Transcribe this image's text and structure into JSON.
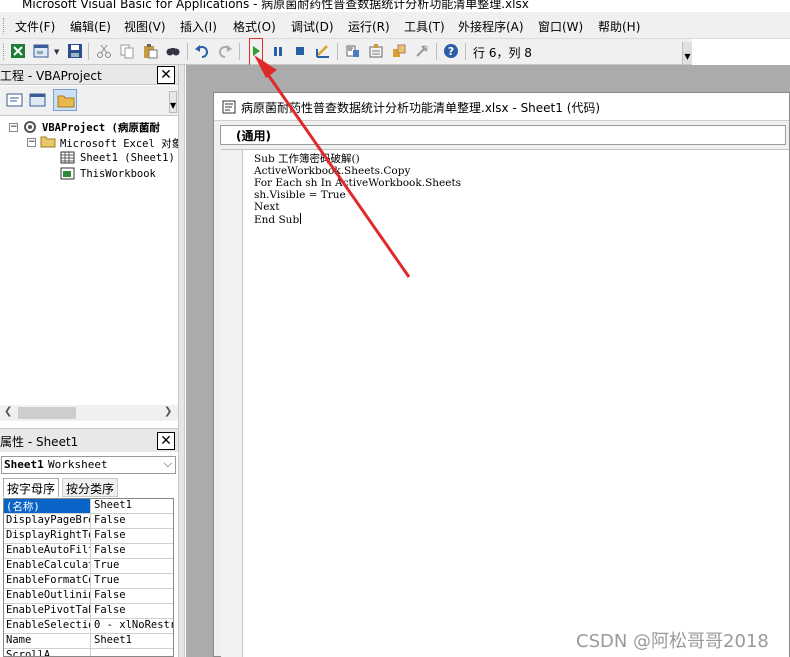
{
  "window": {
    "title": "Microsoft Visual Basic for Applications - 病原菌耐药性普查数据统计分析功能清单整理.xlsx"
  },
  "menubar": {
    "items": [
      {
        "label": "文件(F)"
      },
      {
        "label": "编辑(E)"
      },
      {
        "label": "视图(V)"
      },
      {
        "label": "插入(I)"
      },
      {
        "label": "格式(O)"
      },
      {
        "label": "调试(D)"
      },
      {
        "label": "运行(R)"
      },
      {
        "label": "工具(T)"
      },
      {
        "label": "外接程序(A)"
      },
      {
        "label": "窗口(W)"
      },
      {
        "label": "帮助(H)"
      }
    ]
  },
  "toolbar": {
    "position_text": "行 6，列 8",
    "icons": [
      "excel-icon",
      "insert-userform-icon",
      "save-icon",
      "cut-icon",
      "copy-icon",
      "paste-icon",
      "find-icon",
      "undo-icon",
      "redo-icon",
      "run-icon",
      "break-icon",
      "reset-icon",
      "design-mode-icon",
      "project-explorer-icon",
      "properties-icon",
      "object-browser-icon",
      "toolbox-icon",
      "help-icon"
    ]
  },
  "project_explorer": {
    "title": "工程 - VBAProject",
    "tree": {
      "root": "VBAProject (病原菌耐",
      "folder": "Microsoft Excel 对象",
      "items": [
        "Sheet1 (Sheet1)",
        "ThisWorkbook"
      ]
    }
  },
  "properties": {
    "title": "属性 - Sheet1",
    "object_name": "Sheet1",
    "object_type": "Worksheet",
    "tabs": [
      "按字母序",
      "按分类序"
    ],
    "rows": [
      {
        "name": "(名称)",
        "value": "Sheet1"
      },
      {
        "name": "DisplayPageBre",
        "value": "False"
      },
      {
        "name": "DisplayRightTo",
        "value": "False"
      },
      {
        "name": "EnableAutoFilt",
        "value": "False"
      },
      {
        "name": "EnableCalculat",
        "value": "True"
      },
      {
        "name": "EnableFormatCo",
        "value": "True"
      },
      {
        "name": "EnableOutlinin",
        "value": "False"
      },
      {
        "name": "EnablePivotTab",
        "value": "False"
      },
      {
        "name": "EnableSelectio",
        "value": "0 - xlNoRestr"
      },
      {
        "name": "Name",
        "value": "Sheet1"
      },
      {
        "name": "ScrollA",
        "value": ""
      }
    ]
  },
  "code_window": {
    "title": "病原菌耐药性普查数据统计分析功能清单整理.xlsx - Sheet1 (代码)",
    "object_dropdown": "(通用)",
    "lines": [
      "Sub 工作簿密码破解()",
      "ActiveWorkbook.Sheets.Copy",
      "For Each sh In ActiveWorkbook.Sheets",
      "sh.Visible = True",
      "Next",
      "End Sub"
    ]
  },
  "watermark": "CSDN @阿松哥哥2018",
  "colors": {
    "annotation_red": "#e02a2a",
    "selection_blue": "#0a64c8",
    "run_green": "#2e9d2e",
    "mdi_gray": "#ababab"
  }
}
